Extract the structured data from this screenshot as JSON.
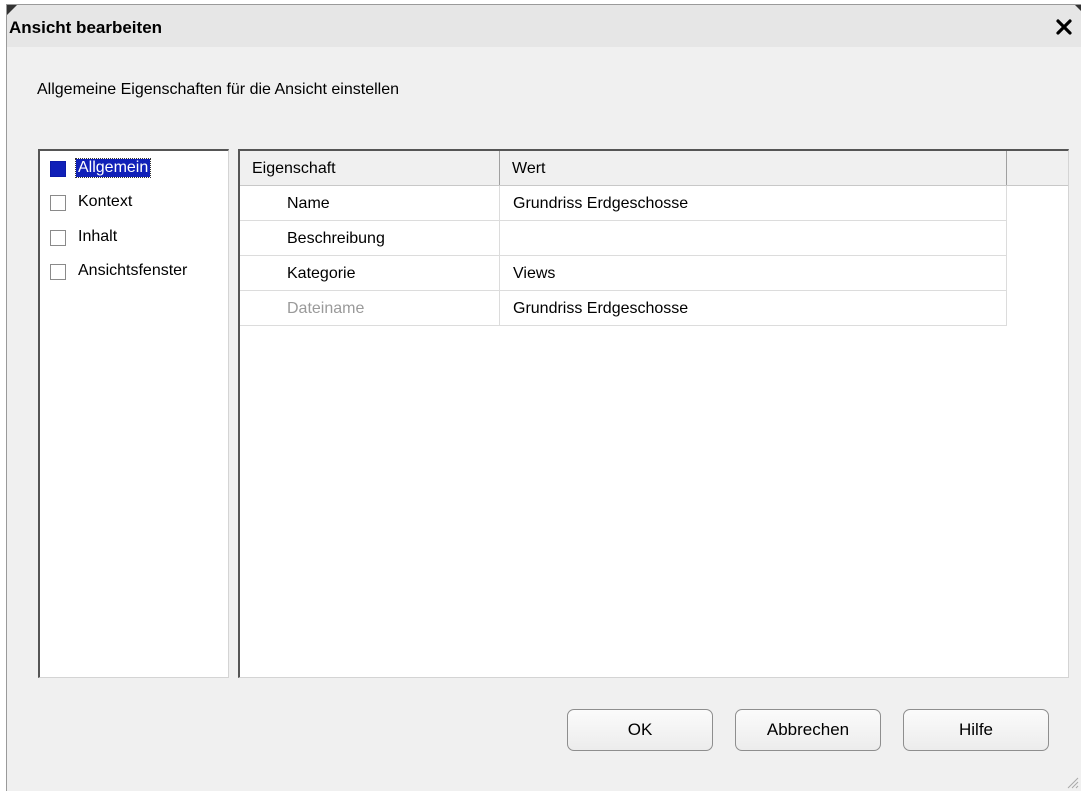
{
  "dialog": {
    "title": "Ansicht bearbeiten",
    "subtitle": "Allgemeine Eigenschaften für die Ansicht einstellen"
  },
  "nav": {
    "items": [
      {
        "label": "Allgemein",
        "checked": true,
        "selected": true
      },
      {
        "label": "Kontext",
        "checked": false,
        "selected": false
      },
      {
        "label": "Inhalt",
        "checked": false,
        "selected": false
      },
      {
        "label": "Ansichtsfenster",
        "checked": false,
        "selected": false
      }
    ]
  },
  "table": {
    "columns": [
      "Eigenschaft",
      "Wert"
    ],
    "rows": [
      {
        "property": "Name",
        "value": "Grundriss Erdgeschosse",
        "disabled": false
      },
      {
        "property": "Beschreibung",
        "value": "",
        "disabled": false
      },
      {
        "property": "Kategorie",
        "value": "Views",
        "disabled": false
      },
      {
        "property": "Dateiname",
        "value": "Grundriss Erdgeschosse",
        "disabled": true
      }
    ]
  },
  "buttons": {
    "ok": "OK",
    "cancel": "Abbrechen",
    "help": "Hilfe"
  },
  "icons": {
    "close": "close-icon",
    "resize": "resize-grip-icon"
  },
  "colors": {
    "selection": "#1020b8",
    "dialog_bg": "#f0f0f0",
    "disabled_text": "#9a9a9a"
  }
}
